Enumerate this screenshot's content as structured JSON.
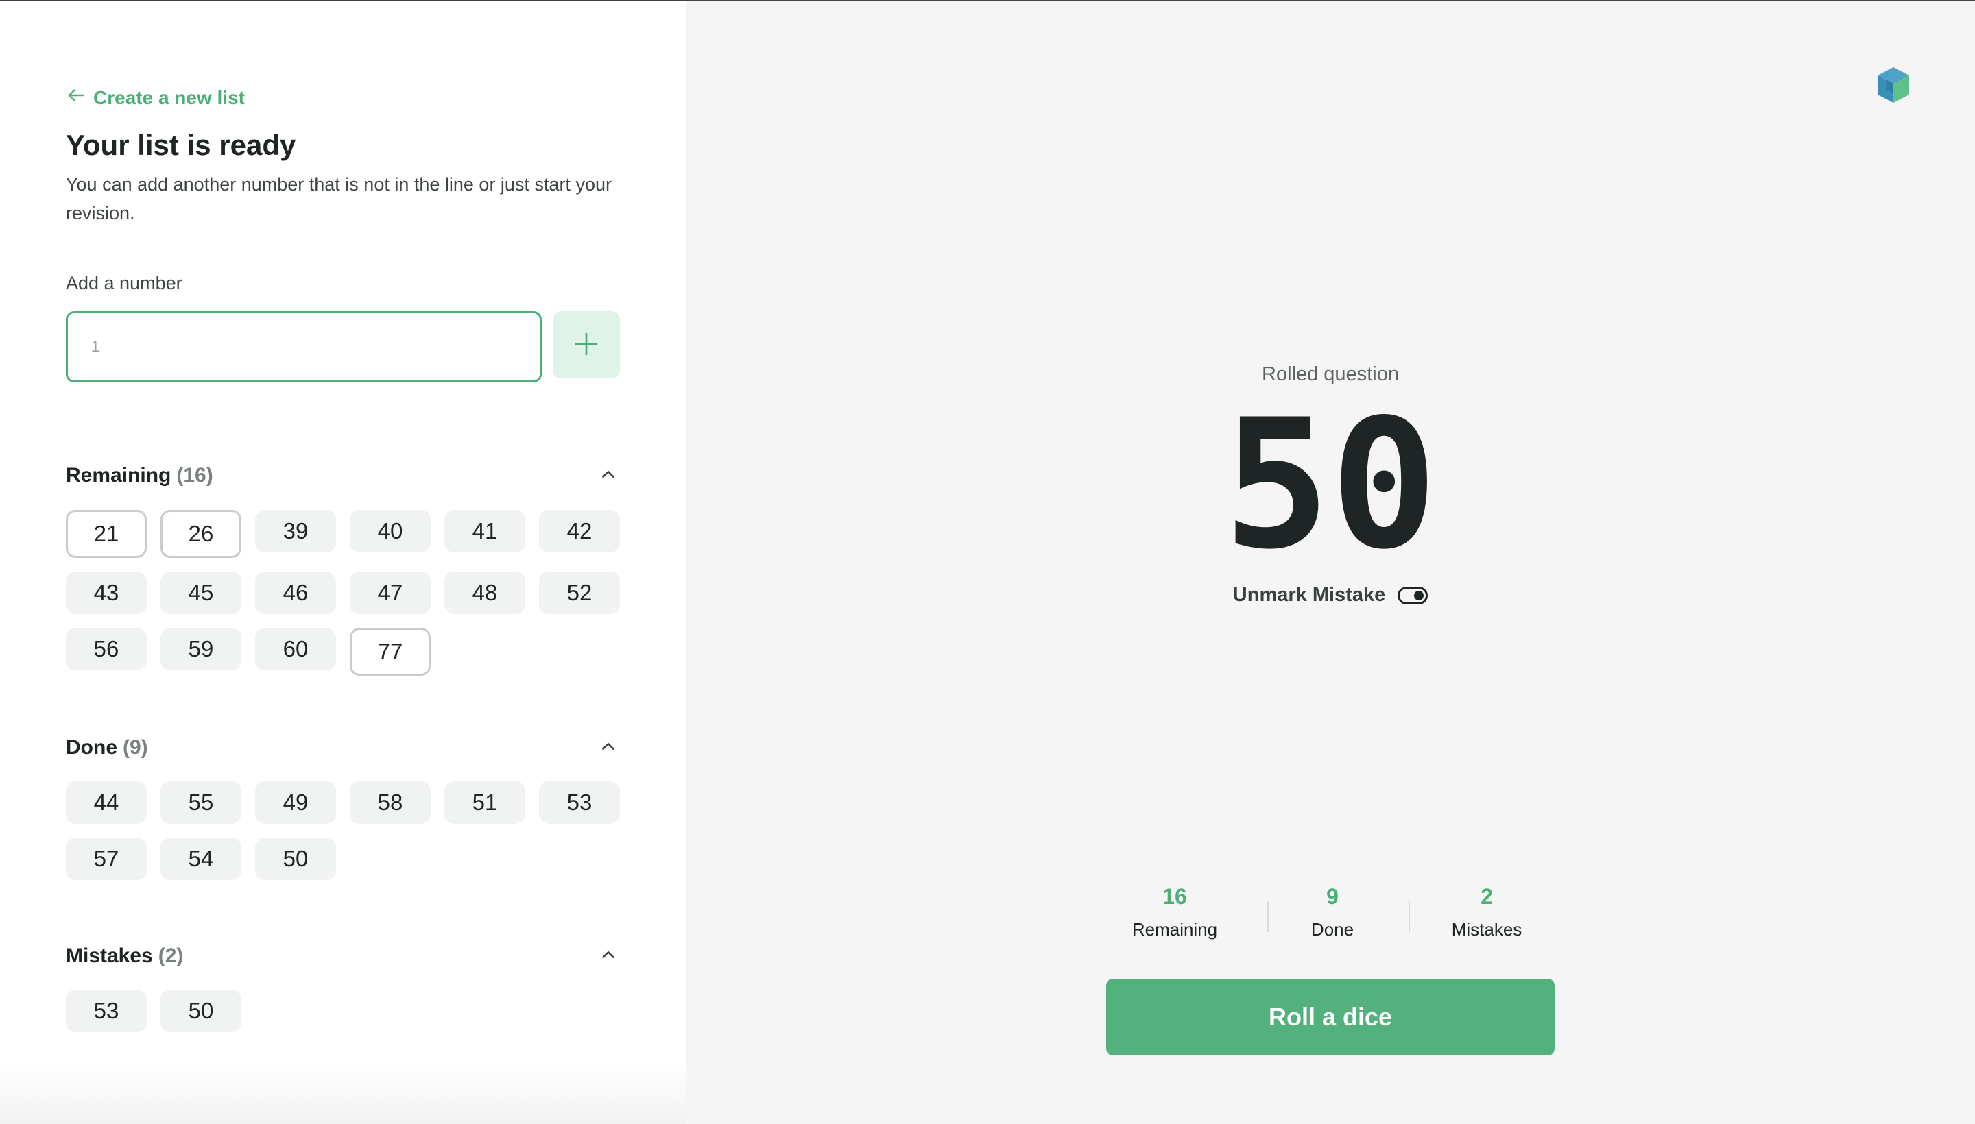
{
  "back_link": {
    "label": "Create a new list"
  },
  "header": {
    "title": "Your list is ready",
    "subtitle": "You can add another number that is not in the line or just start your revision."
  },
  "add_number": {
    "label": "Add a number",
    "placeholder": "1",
    "value": ""
  },
  "sections": {
    "remaining": {
      "title": "Remaining",
      "count": "(16)",
      "items": [
        "21",
        "26",
        "39",
        "40",
        "41",
        "42",
        "43",
        "45",
        "46",
        "47",
        "48",
        "52",
        "56",
        "59",
        "60",
        "77"
      ],
      "outlined": [
        "21",
        "26",
        "77"
      ]
    },
    "done": {
      "title": "Done",
      "count": "(9)",
      "items": [
        "44",
        "55",
        "49",
        "58",
        "51",
        "53",
        "57",
        "54",
        "50"
      ]
    },
    "mistakes": {
      "title": "Mistakes",
      "count": "(2)",
      "items": [
        "53",
        "50"
      ]
    }
  },
  "rolled": {
    "label": "Rolled question",
    "number": "50",
    "unmark_label": "Unmark Mistake",
    "toggle_on": true
  },
  "stats": {
    "remaining": {
      "value": "16",
      "label": "Remaining"
    },
    "done": {
      "value": "9",
      "label": "Done"
    },
    "mistakes": {
      "value": "2",
      "label": "Mistakes"
    }
  },
  "roll_button": {
    "label": "Roll a dice"
  },
  "colors": {
    "accent": "#4caf78",
    "button": "#52b17d",
    "chip_bg": "#f1f2f2",
    "panel_bg": "#f4f5f4"
  },
  "icons": {
    "back": "arrow-left-icon",
    "add": "plus-icon",
    "collapse": "chevron-up-icon",
    "logo": "cube-logo-icon",
    "toggle": "toggle-icon"
  }
}
